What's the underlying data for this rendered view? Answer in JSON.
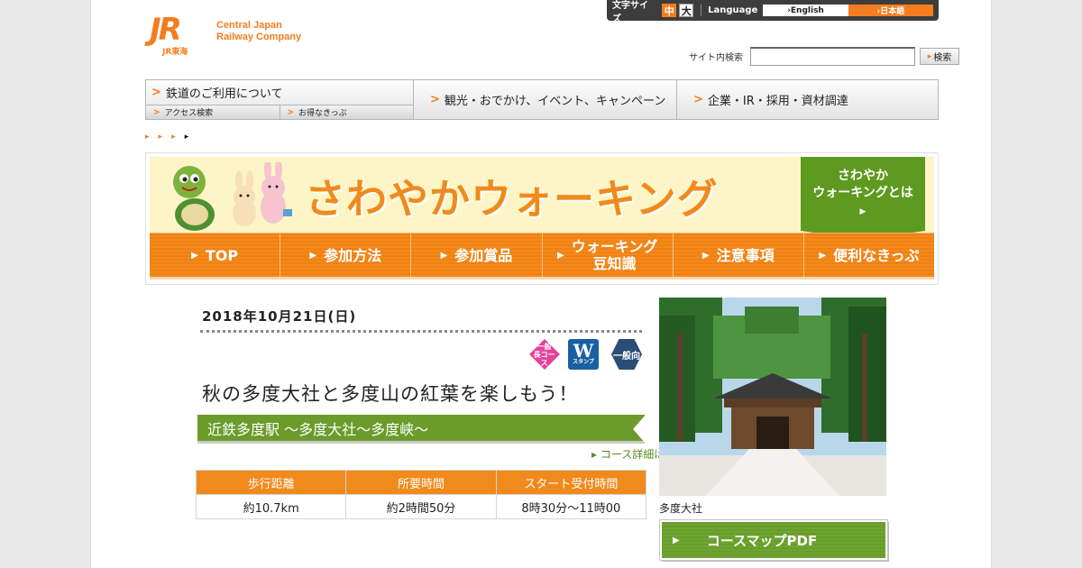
{
  "brand": {
    "jr": "JR",
    "jr_sub": "JR東海",
    "name_line1": "Central Japan",
    "name_line2": "Railway Company"
  },
  "utility": {
    "font_size_label": "文字サイズ",
    "font_mid": "中",
    "font_big": "大",
    "language_label": "Language",
    "english": "›English",
    "japanese": "›日本語"
  },
  "search": {
    "label": "サイト内検索",
    "value": "",
    "button": "検索"
  },
  "nav": {
    "rail": "鉄道のご利用について",
    "access": "アクセス検索",
    "tickets": "お得なきっぷ",
    "tourism": "観光・おでかけ、イベント、キャンペーン",
    "corporate": "企業・IR・採用・資材調達"
  },
  "banner": {
    "title": "さわやかウォーキング",
    "about_line1": "さわやか",
    "about_line2": "ウォーキングとは",
    "about_arrow": "▶",
    "menu": [
      {
        "label1": "TOP",
        "label2": ""
      },
      {
        "label1": "参加方法",
        "label2": ""
      },
      {
        "label1": "参加賞品",
        "label2": ""
      },
      {
        "label1": "ウォーキング",
        "label2": "豆知識"
      },
      {
        "label1": "注意事項",
        "label2": ""
      },
      {
        "label1": "便利なきっぷ",
        "label2": ""
      }
    ]
  },
  "event": {
    "date": "2018年10月21日(日)",
    "badge_pink": "一般\n長コース",
    "badge_w": "W",
    "badge_w_sub": "スタンプ",
    "badge_hex": "一般向",
    "title": "秋の多度大社と多度山の紅葉を楽しもう！",
    "route": "近鉄多度駅 ～多度大社～多度峡～",
    "detail_link": "コース詳細はこちら",
    "table": {
      "headers": [
        "歩行距離",
        "所要時間",
        "スタート受付時間"
      ],
      "values": [
        "約10.7km",
        "約2時間50分",
        "8時30分～11時00"
      ]
    }
  },
  "side": {
    "caption": "多度大社",
    "pdf_button": "コースマップPDF"
  }
}
